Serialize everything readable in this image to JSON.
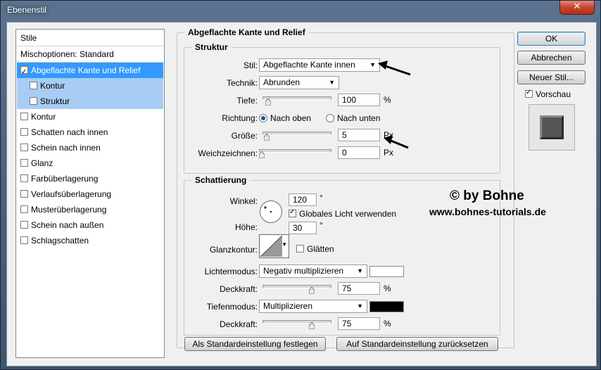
{
  "window": {
    "title": "Ebenenstil",
    "close_glyph": "✕"
  },
  "stylelist": {
    "header": "Stile",
    "blend_options": "Mischoptionen: Standard",
    "items": [
      {
        "label": "Abgeflachte Kante und Relief",
        "checked": true
      },
      {
        "label": "Kontur",
        "checked": false
      },
      {
        "label": "Struktur",
        "checked": false
      },
      {
        "label": "Kontur",
        "checked": false
      },
      {
        "label": "Schatten nach innen",
        "checked": false
      },
      {
        "label": "Schein nach innen",
        "checked": false
      },
      {
        "label": "Glanz",
        "checked": false
      },
      {
        "label": "Farbüberlagerung",
        "checked": false
      },
      {
        "label": "Verlaufsüberlagerung",
        "checked": false
      },
      {
        "label": "Musterüberlagerung",
        "checked": false
      },
      {
        "label": "Schein nach außen",
        "checked": false
      },
      {
        "label": "Schlagschatten",
        "checked": false
      }
    ]
  },
  "main": {
    "title": "Abgeflachte Kante und Relief",
    "struktur": {
      "legend": "Struktur",
      "stil_label": "Stil:",
      "stil_value": "Abgeflachte Kante innen",
      "technik_label": "Technik:",
      "technik_value": "Abrunden",
      "tiefe_label": "Tiefe:",
      "tiefe_value": "100",
      "tiefe_unit": "%",
      "tiefe_slider": 0.05,
      "richtung_label": "Richtung:",
      "richtung_up": "Nach oben",
      "richtung_down": "Nach unten",
      "groesse_label": "Größe:",
      "groesse_value": "5",
      "groesse_unit": "Px",
      "groesse_slider": 0.02,
      "weich_label": "Weichzeichnen:",
      "weich_value": "0",
      "weich_unit": "Px",
      "weich_slider": 0.0
    },
    "schattierung": {
      "legend": "Schattierung",
      "winkel_label": "Winkel:",
      "winkel_value": "120",
      "winkel_unit": "°",
      "global_light": "Globales Licht verwenden",
      "hoehe_label": "Höhe:",
      "hoehe_value": "30",
      "hoehe_unit": "°",
      "glanzkontur_label": "Glanzkontur:",
      "glaetten": "Glätten",
      "lichtermodus_label": "Lichtermodus:",
      "lichtermodus_value": "Negativ multiplizieren",
      "lichter_color": "#ffffff",
      "deckkraft1_label": "Deckkraft:",
      "deckkraft1_value": "75",
      "deckkraft1_unit": "%",
      "deckkraft1_slider": 0.75,
      "tiefenmodus_label": "Tiefenmodus:",
      "tiefenmodus_value": "Multiplizieren",
      "tiefen_color": "#000000",
      "deckkraft2_label": "Deckkraft:",
      "deckkraft2_value": "75",
      "deckkraft2_unit": "%",
      "deckkraft2_slider": 0.75
    },
    "btn_set_default": "Als Standardeinstellung festlegen",
    "btn_reset_default": "Auf Standardeinstellung zurücksetzen"
  },
  "buttons": {
    "ok": "OK",
    "cancel": "Abbrechen",
    "new_style": "Neuer Stil...",
    "preview": "Vorschau"
  },
  "watermark": {
    "line1": "© by Bohne",
    "line2": "www.bohnes-tutorials.de"
  }
}
